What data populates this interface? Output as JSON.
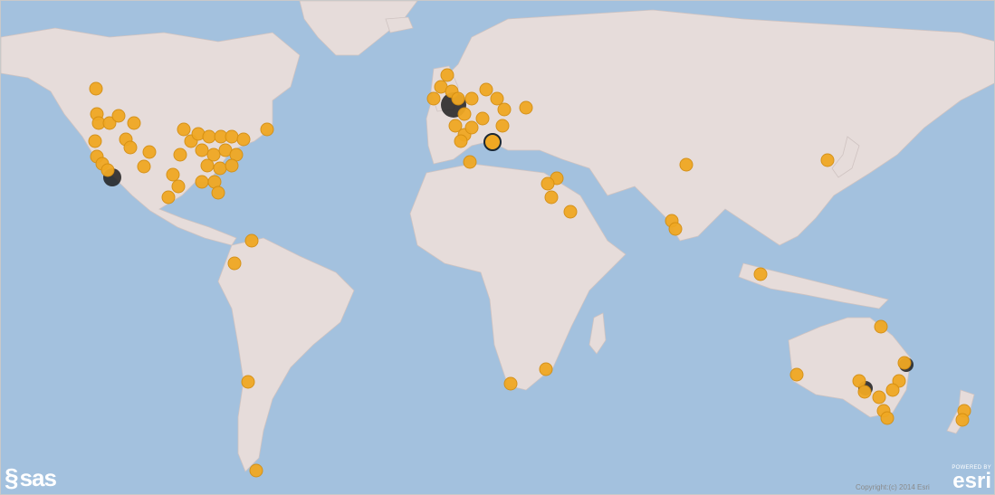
{
  "map": {
    "ocean_color": "#a3c1de",
    "land_color": "#e6dcda",
    "marker_color": "#f0a823",
    "marker_shadow_color": "#1f1f1f"
  },
  "logos": {
    "sas_text": "sas",
    "esri_powered": "POWERED BY",
    "esri_text": "esri"
  },
  "attribution": {
    "copyright": "Copyright:(c) 2014 Esri"
  }
}
